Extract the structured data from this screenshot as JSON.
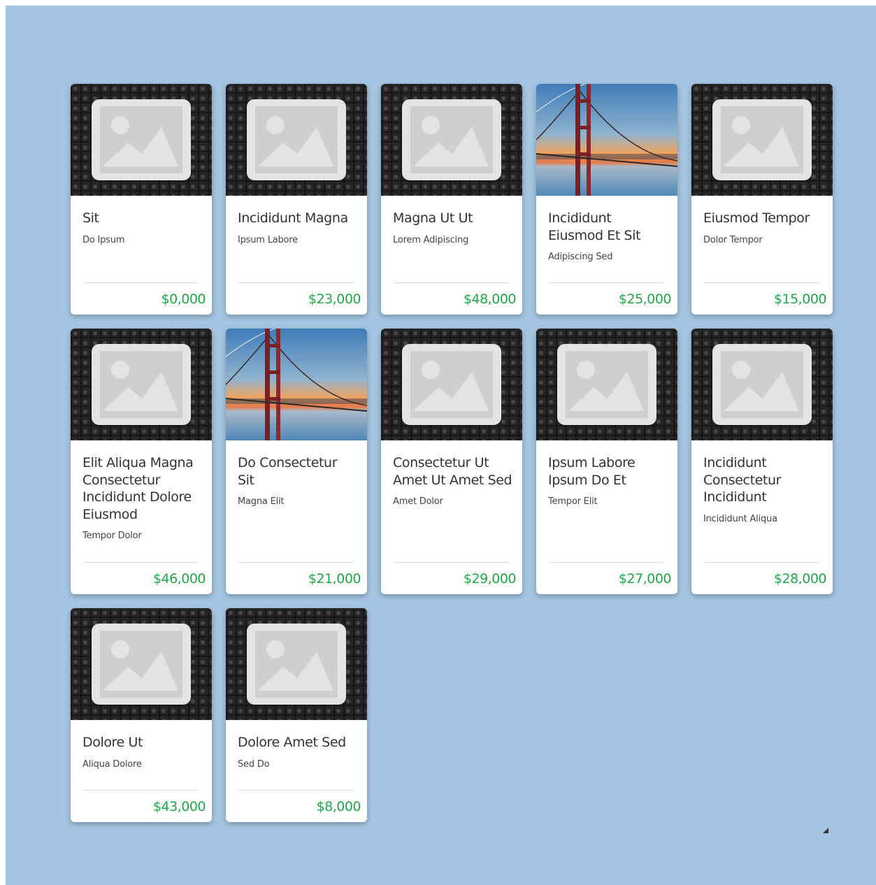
{
  "cards": [
    {
      "title": "Sit",
      "subtitle": "Do Ipsum",
      "price": "$0,000",
      "image": "placeholder-image-icon"
    },
    {
      "title": "Incididunt Magna",
      "subtitle": "Ipsum Labore",
      "price": "$23,000",
      "image": "placeholder-image-icon"
    },
    {
      "title": "Magna Ut Ut",
      "subtitle": "Lorem Adipiscing",
      "price": "$48,000",
      "image": "placeholder-image-icon"
    },
    {
      "title": "Incididunt Eiusmod Et Sit",
      "subtitle": "Adipiscing Sed",
      "price": "$25,000",
      "image": "bridge-photo"
    },
    {
      "title": "Eiusmod Tempor",
      "subtitle": "Dolor Tempor",
      "price": "$15,000",
      "image": "placeholder-image-icon"
    },
    {
      "title": "Elit Aliqua Magna Consectetur Incididunt Dolore Eiusmod",
      "subtitle": "Tempor Dolor",
      "price": "$46,000",
      "image": "placeholder-image-icon"
    },
    {
      "title": "Do Consectetur Sit",
      "subtitle": "Magna Elit",
      "price": "$21,000",
      "image": "bridge-photo"
    },
    {
      "title": "Consectetur Ut Amet Ut Amet Sed",
      "subtitle": "Amet Dolor",
      "price": "$29,000",
      "image": "placeholder-image-icon"
    },
    {
      "title": "Ipsum Labore Ipsum Do Et",
      "subtitle": "Tempor Elit",
      "price": "$27,000",
      "image": "placeholder-image-icon"
    },
    {
      "title": "Incididunt Consectetur Incididunt",
      "subtitle": "Incididunt Aliqua",
      "price": "$28,000",
      "image": "placeholder-image-icon"
    },
    {
      "title": "Dolore Ut",
      "subtitle": "Aliqua Dolore",
      "price": "$43,000",
      "image": "placeholder-image-icon"
    },
    {
      "title": "Dolore Amet Sed",
      "subtitle": "Sed Do",
      "price": "$8,000",
      "image": "placeholder-image-icon"
    }
  ],
  "colors": {
    "background": "#a4c5e2",
    "price": "#1fa848",
    "card": "#ffffff"
  }
}
